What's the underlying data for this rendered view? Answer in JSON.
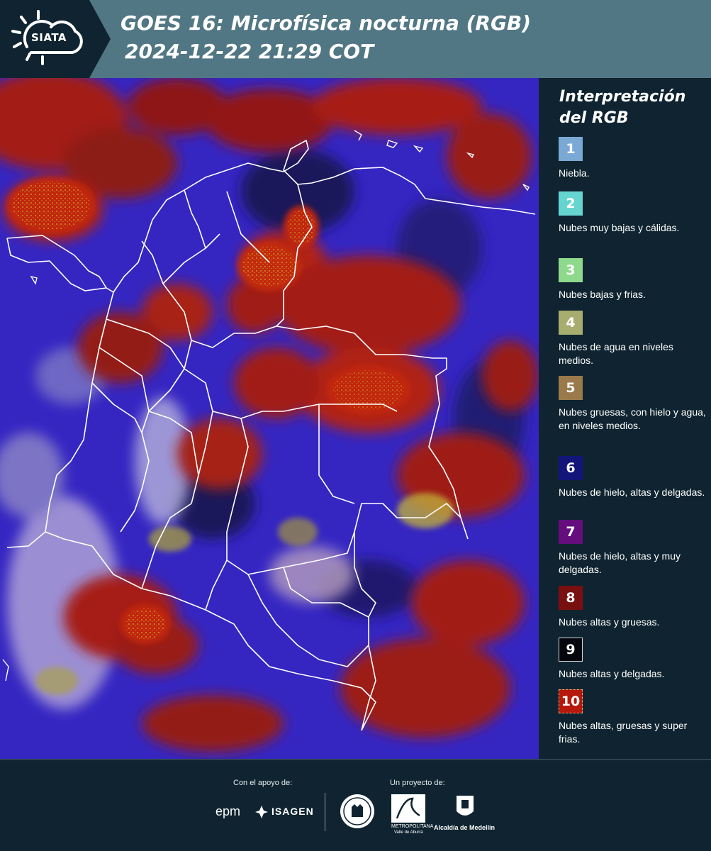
{
  "header": {
    "logo_text": "SIATA",
    "title_line1": "GOES 16: Microfísica nocturna (RGB)",
    "title_line2": "2024-12-22 21:29 COT"
  },
  "sidebar": {
    "title": "Interpretación del RGB",
    "items": [
      {
        "num": "1",
        "label": "Niebla.",
        "color": "#7ba9d6"
      },
      {
        "num": "2",
        "label": "Nubes muy bajas y cálidas.",
        "color": "#67d5cf"
      },
      {
        "num": "3",
        "label": "Nubes bajas y frias.",
        "color": "#8fd98c"
      },
      {
        "num": "4",
        "label": "Nubes de agua en niveles medios.",
        "color": "#a7ad6e"
      },
      {
        "num": "5",
        "label": "Nubes gruesas, con hielo y agua, en niveles medios.",
        "color": "#9a7a4a"
      },
      {
        "num": "6",
        "label": "Nubes de hielo, altas y delgadas.",
        "color": "#14157a"
      },
      {
        "num": "7",
        "label": "Nubes de hielo, altas y muy delgadas.",
        "color": "#650d7d"
      },
      {
        "num": "8",
        "label": "Nubes altas y gruesas.",
        "color": "#7a0f0f"
      },
      {
        "num": "9",
        "label": "Nubes altas y delgadas.",
        "color": "#05050d"
      },
      {
        "num": "10",
        "label": "Nubes altas, gruesas y super frias.",
        "color": "#b8170b"
      }
    ]
  },
  "footer": {
    "support_label": "Con el apoyo de:",
    "project_label": "Un proyecto de:",
    "sponsor_epm": "epm",
    "sponsor_isagen": "ISAGEN",
    "partner_area": "METROPOLITANA",
    "partner_area_sub": "Valle de Aburrá",
    "partner_medellin": "Alcaldía de Medellín"
  }
}
